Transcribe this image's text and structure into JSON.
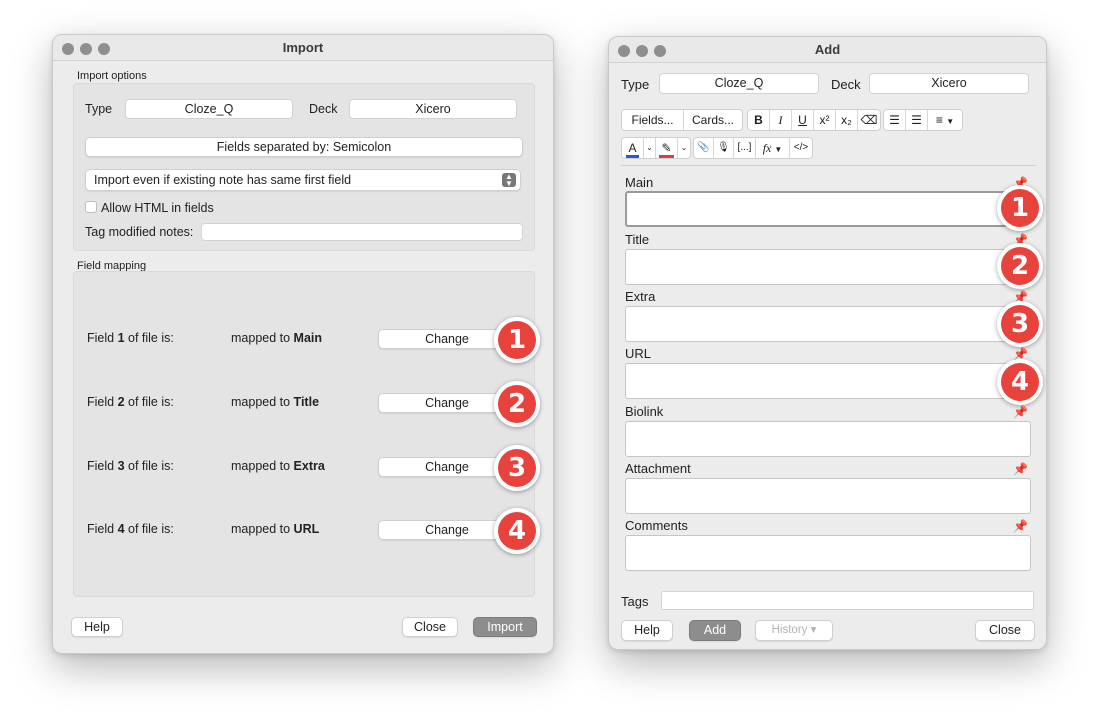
{
  "import_window": {
    "title": "Import",
    "import_options_label": "Import options",
    "type_label": "Type",
    "type_value": "Cloze_Q",
    "deck_label": "Deck",
    "deck_value": "Xicero",
    "separator_button": "Fields separated by: Semicolon",
    "duplicate_option": "Import even if existing note has same first field",
    "allow_html_label": "Allow HTML in fields",
    "tag_modified_label": "Tag modified notes:",
    "tag_modified_value": "",
    "field_mapping_label": "Field mapping",
    "mappings": [
      {
        "pre": "Field ",
        "num": "1",
        "post": " of file is:",
        "mapped_pre": "mapped to ",
        "mapped_field": "Main",
        "button": "Change",
        "badge": "1"
      },
      {
        "pre": "Field ",
        "num": "2",
        "post": " of file is:",
        "mapped_pre": "mapped to ",
        "mapped_field": "Title",
        "button": "Change",
        "badge": "2"
      },
      {
        "pre": "Field ",
        "num": "3",
        "post": " of file is:",
        "mapped_pre": "mapped to ",
        "mapped_field": "Extra",
        "button": "Change",
        "badge": "3"
      },
      {
        "pre": "Field ",
        "num": "4",
        "post": " of file is:",
        "mapped_pre": "mapped to ",
        "mapped_field": "URL",
        "button": "Change",
        "badge": "4"
      }
    ],
    "help_button": "Help",
    "close_button": "Close",
    "import_button": "Import"
  },
  "add_window": {
    "title": "Add",
    "type_label": "Type",
    "type_value": "Cloze_Q",
    "deck_label": "Deck",
    "deck_value": "Xicero",
    "toolbar": {
      "fields_button": "Fields...",
      "cards_button": "Cards...",
      "bold": "B",
      "italic": "I",
      "underline": "U",
      "superscript": "x²",
      "subscript": "x₂",
      "eraser": "⌫",
      "bullet_list": "☰",
      "numbered_list": "☰",
      "align": "≡",
      "text_color": "A",
      "highlight": "✎",
      "attach": "📎",
      "record": "🎙",
      "cloze": "[...]",
      "mathjax": "fx",
      "html": "</>"
    },
    "fields": [
      {
        "name": "Main",
        "badge": "1",
        "pinned": false
      },
      {
        "name": "Title",
        "badge": "2",
        "pinned": true
      },
      {
        "name": "Extra",
        "badge": "3",
        "pinned": true
      },
      {
        "name": "URL",
        "badge": "4",
        "pinned": true
      },
      {
        "name": "Biolink",
        "badge": "",
        "pinned": false
      },
      {
        "name": "Attachment",
        "badge": "",
        "pinned": false
      },
      {
        "name": "Comments",
        "badge": "",
        "pinned": false
      }
    ],
    "tags_label": "Tags",
    "tags_value": "",
    "help_button": "Help",
    "add_button": "Add",
    "history_button": "History ▾",
    "close_button": "Close"
  },
  "colors": {
    "badge_red": "#e8423c",
    "text_color_underline": "#2b57d8",
    "highlight_underline": "#e23b3b",
    "primary_button": "#8d8d8d"
  }
}
